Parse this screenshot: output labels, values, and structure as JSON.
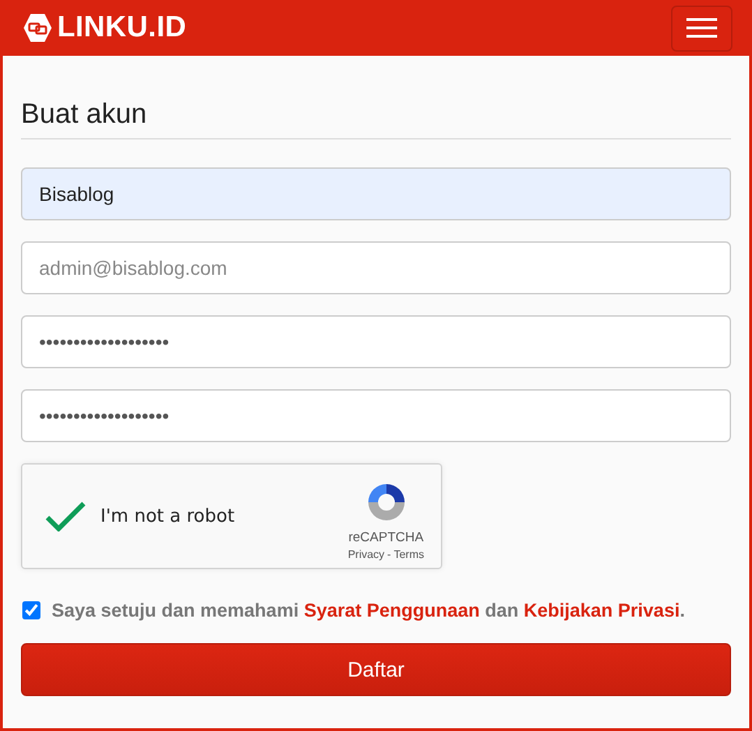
{
  "navbar": {
    "brand": "LINKU.ID"
  },
  "form": {
    "title": "Buat akun",
    "fields": [
      {
        "value": "Bisablog",
        "autofilled": true
      },
      {
        "placeholder": "admin@bisablog.com",
        "autofilled": false
      },
      {
        "value": "•••••••••••••••••••",
        "autofilled": false
      },
      {
        "value": "•••••••••••••••••••",
        "autofilled": false
      }
    ],
    "captcha": {
      "label": "I'm not a robot",
      "checked": true,
      "brand": "reCAPTCHA",
      "privacy": "Privacy",
      "separator": "-",
      "terms": "Terms"
    },
    "agreement": {
      "checked": true,
      "parts": [
        {
          "kind": "text",
          "text": "Saya setuju dan memahami "
        },
        {
          "kind": "link",
          "text": "Syarat Penggunaan"
        },
        {
          "kind": "text",
          "text": " dan "
        },
        {
          "kind": "link",
          "text": "Kebijakan Privasi"
        },
        {
          "kind": "text",
          "text": "."
        }
      ]
    },
    "submit": "Daftar"
  }
}
